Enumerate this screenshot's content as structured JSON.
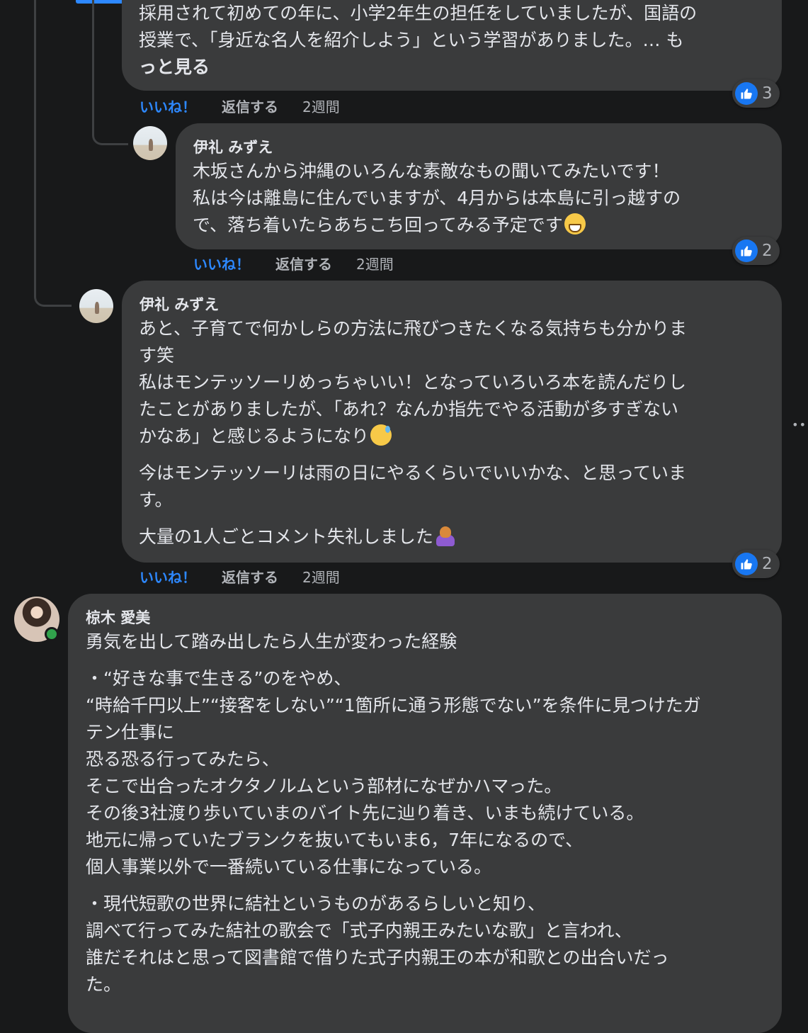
{
  "comments": [
    {
      "lines": [
        "採用されて初めての年に、小学2年生の担任をしていましたが、国語の",
        "授業で、「身近な名人を紹介しよう」という学習がありました。… も",
        "っと見る"
      ],
      "actions": {
        "like": "いいね！",
        "reply": "返信する",
        "time": "2週間"
      },
      "reaction_count": "3"
    },
    {
      "author": "伊礼 みずえ",
      "lines": [
        "木坂さんから沖縄のいろんな素敵なもの聞いてみたいです！",
        "私は今は離島に住んでいますが、4月からは本島に引っ越すの",
        "で、落ち着いたらあちこち回ってみる予定です"
      ],
      "actions": {
        "like": "いいね！",
        "reply": "返信する",
        "time": "2週間"
      },
      "reaction_count": "2"
    },
    {
      "author": "伊礼 みずえ",
      "lines": [
        "あと、子育てで何かしらの方法に飛びつきたくなる気持ちも分かりま",
        "す笑",
        "私はモンテッソーリめっちゃいい！となっていろいろ本を読んだりし",
        "たことがありましたが、「あれ？なんか指先でやる活動が多すぎない",
        "かなあ」と感じるようになり",
        "今はモンテッソーリは雨の日にやるくらいでいいかな、と思っていま",
        "す。",
        "大量の1人ごとコメント失礼しました"
      ],
      "actions": {
        "like": "いいね！",
        "reply": "返信する",
        "time": "2週間"
      },
      "reaction_count": "2"
    },
    {
      "author": "椋木 愛美",
      "lines": [
        "勇気を出して踏み出したら人生が変わった経験",
        "・“好きな事で生きる”のをやめ、",
        "“時給千円以上”“接客をしない”“1箇所に通う形態でない”を条件に見つけたガ",
        "テン仕事に",
        "恐る恐る行ってみたら、",
        "そこで出合ったオクタノルムという部材になぜかハマった。",
        "その後3社渡り歩いていまのバイト先に辿り着き、いまも続けている。",
        "地元に帰っていたブランクを抜いてもいま6，7年になるので、",
        "個人事業以外で一番続いている仕事になっている。",
        "・現代短歌の世界に結社というものがあるらしいと知り、",
        "調べて行ってみた結社の歌会で「式子内親王みたいな歌」と言われ、",
        "誰だそれはと思って図書館で借りた式子内親王の本が和歌との出合いだっ",
        "た。"
      ]
    }
  ],
  "colors": {
    "background": "#18191a",
    "bubble": "#3a3b3c",
    "link": "#2d88ff",
    "like_badge": "#1877f2"
  },
  "icons": {
    "reaction": "thumbs-up-icon",
    "emoji_grin": "grinning-face-icon",
    "emoji_sweat": "sweat-smile-icon",
    "emoji_bow": "bowing-person-icon"
  }
}
